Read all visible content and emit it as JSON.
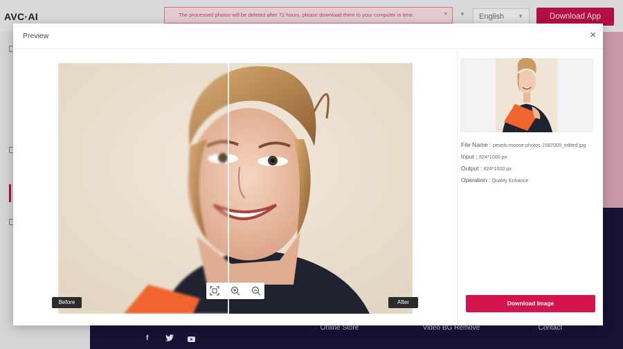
{
  "app": {
    "logo": "AVC·AI"
  },
  "notice": {
    "text": "The processed photos will be deleted after 72 hours, please download them to your computer in time.",
    "close": "×"
  },
  "header": {
    "language": "English",
    "download_app": "Download App"
  },
  "footer": {
    "links": [
      "Online Store",
      "Video BG Remove",
      "Contact"
    ],
    "social": [
      "facebook-icon",
      "twitter-icon",
      "youtube-icon"
    ]
  },
  "modal": {
    "title": "Preview",
    "close": "×",
    "before_label": "Before",
    "after_label": "After",
    "zoom_controls": [
      "fit-screen-icon",
      "zoom-in-icon",
      "zoom-out-icon"
    ],
    "file": {
      "name_label": "File Name :",
      "name": "pexels-moose-photos-1587009_edited.jpg",
      "input_label": "Input :",
      "input": "824*1000 px",
      "output_label": "Output :",
      "output": "824*1000 px",
      "operation_label": "Operation :",
      "operation": "Quality Enhance"
    },
    "download_image": "Download Image"
  },
  "colors": {
    "accent": "#d3154b",
    "brand_dark": "#b30f43",
    "footer_bg": "#151233",
    "shirt": "#1f2330",
    "folder": "#f0652f"
  }
}
